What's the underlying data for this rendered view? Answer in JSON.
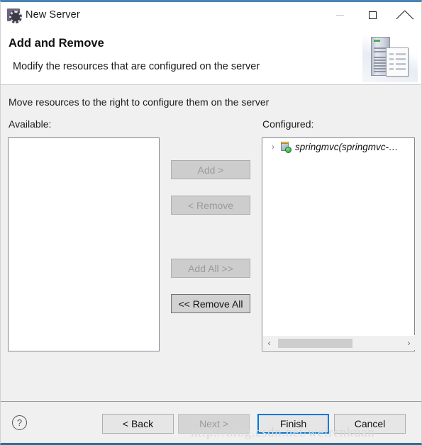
{
  "window": {
    "title": "New Server",
    "icon": "server-gear-icon",
    "controls": {
      "minimize": "minimize-icon",
      "maximize": "maximize-icon",
      "close": "close-icon"
    }
  },
  "header": {
    "title": "Add and Remove",
    "subtitle": "Modify the resources that are configured on the server",
    "artwork": "server-and-document-illustration"
  },
  "body": {
    "instruction": "Move resources to the right to configure them on the server",
    "available": {
      "label": "Available:",
      "items": []
    },
    "configured": {
      "label": "Configured:",
      "items": [
        {
          "expander": "›",
          "icon": "web-module-icon",
          "label": "springmvc(springmvc-…"
        }
      ],
      "scrollbar": {
        "left_arrow": "‹",
        "right_arrow": "›"
      }
    },
    "transfer_buttons": [
      {
        "id": "add",
        "label": "Add >",
        "enabled": false
      },
      {
        "id": "remove",
        "label": "< Remove",
        "enabled": false
      },
      {
        "id": "add-all",
        "label": "Add All >>",
        "enabled": false
      },
      {
        "id": "remove-all",
        "label": "<< Remove All",
        "enabled": true
      }
    ]
  },
  "footer": {
    "help": "?",
    "buttons": [
      {
        "id": "back",
        "label": "< Back",
        "state": "normal"
      },
      {
        "id": "next",
        "label": "Next >",
        "state": "disabled"
      },
      {
        "id": "finish",
        "label": "Finish",
        "state": "focused"
      },
      {
        "id": "cancel",
        "label": "Cancel",
        "state": "normal"
      }
    ]
  },
  "watermark": "http://blog.csdn.net/weirenkuan",
  "colors": {
    "accent_top": "#4a84b4",
    "accent_bottom": "#2b6f92",
    "focus_border": "#0078d7",
    "panel": "#f0f0f0",
    "list_background": "#ffffff"
  }
}
